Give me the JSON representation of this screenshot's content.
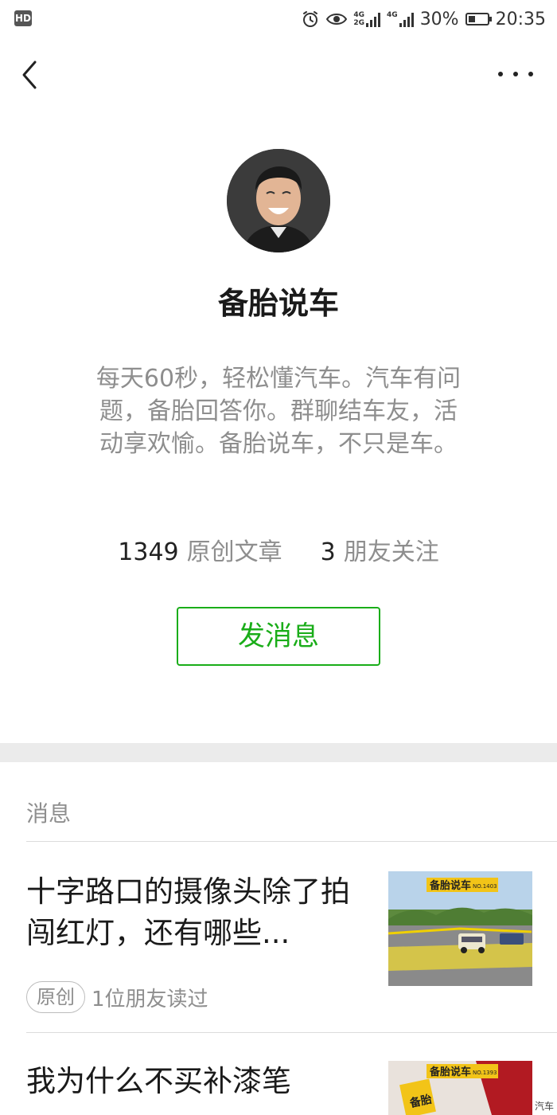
{
  "status_bar": {
    "hd": "HD",
    "net1_top": "4G",
    "net1_bottom": "2G",
    "net2": "4G",
    "battery": "30%",
    "time": "20:35"
  },
  "profile": {
    "name": "备胎说车",
    "intro": "每天60秒，轻松懂汽车。汽车有问题，备胎回答你。群聊结车友，活动享欢愉。备胎说车，不只是车。",
    "articles_count": "1349",
    "articles_label": "原创文章",
    "friends_count": "3",
    "friends_label": "朋友关注",
    "send_button": "发消息"
  },
  "messages": {
    "section_title": "消息",
    "items": [
      {
        "title": "十字路口的摄像头除了拍闯红灯，还有哪些...",
        "tag": "原创",
        "read_info": "1位朋友读过",
        "thumb_banner": "备胎说车",
        "thumb_no": "NO.1403"
      },
      {
        "title": "我为什么不买补漆笔",
        "thumb_banner": "备胎说车",
        "thumb_no": "NO.1393",
        "thumb_vertical": "备胎"
      }
    ]
  },
  "watermark": "汽车",
  "colors": {
    "accent": "#1aad19",
    "secondary_text": "#8e8e8e",
    "divider": "#ebebeb"
  }
}
